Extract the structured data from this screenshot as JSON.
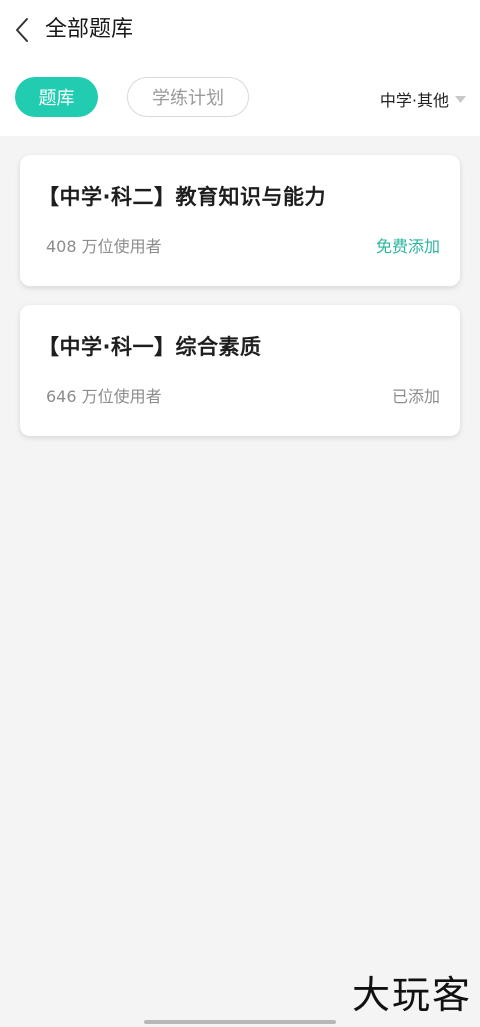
{
  "header": {
    "title": "全部题库",
    "back_icon": "chevron-left-icon"
  },
  "tabs": [
    {
      "label": "题库",
      "active": true
    },
    {
      "label": "学练计划",
      "active": false
    }
  ],
  "filter": {
    "label": "中学·其他",
    "icon": "caret-down-icon"
  },
  "cards": [
    {
      "title": "【中学·科二】教育知识与能力",
      "users": "408 万位使用者",
      "action": "免费添加"
    },
    {
      "title": "【中学·科一】综合素质",
      "users": "646 万位使用者",
      "action": "已添加"
    }
  ],
  "watermark": "大玩客",
  "colors": {
    "accent": "#22ccb0",
    "action_text": "#2cb59f",
    "muted_text": "#8c8c8c",
    "background": "#f4f4f4"
  }
}
